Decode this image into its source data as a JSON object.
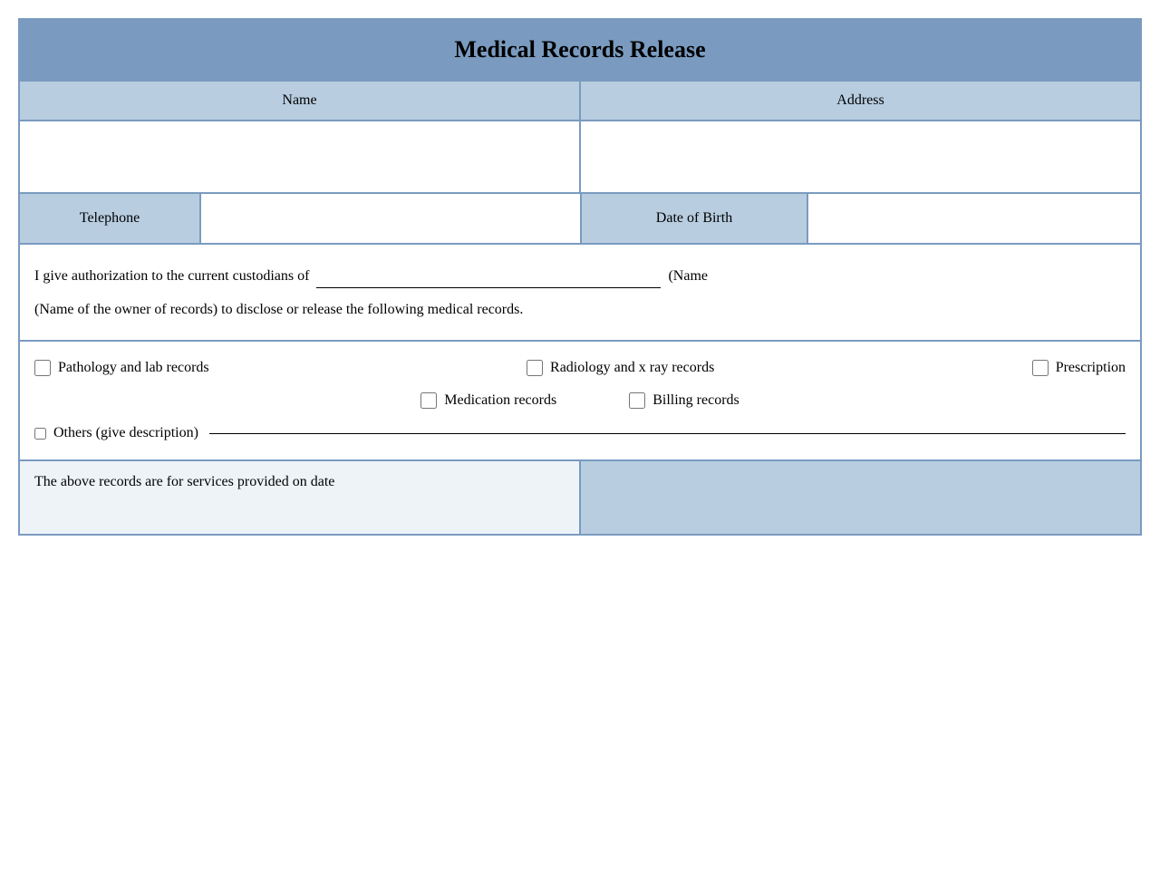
{
  "title": "Medical Records Release",
  "fields": {
    "name_label": "Name",
    "address_label": "Address",
    "telephone_label": "Telephone",
    "dob_label": "Date of Birth"
  },
  "auth": {
    "text_before": "I give authorization to the current custodians of",
    "text_after": "(Name of the owner of records) to disclose or release the following medical records."
  },
  "checkboxes": {
    "pathology": "Pathology and lab records",
    "radiology": "Radiology and x ray records",
    "prescription": "Prescription",
    "medication": "Medication records",
    "billing": "Billing records",
    "others": "Others (give description)"
  },
  "bottom": {
    "left_text": "The above records are for services provided on date"
  }
}
